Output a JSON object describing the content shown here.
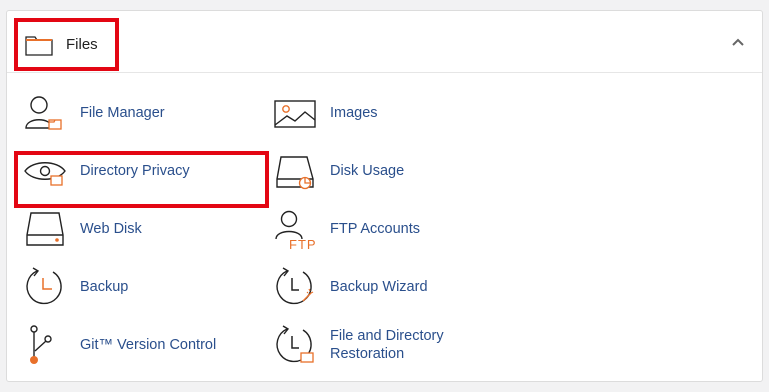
{
  "panel": {
    "title": "Files",
    "collapse_icon": "chevron-up-icon"
  },
  "items": [
    {
      "label": "File Manager",
      "icon": "file-manager-icon"
    },
    {
      "label": "Images",
      "icon": "images-icon"
    },
    {
      "label": "Directory Privacy",
      "icon": "directory-privacy-icon"
    },
    {
      "label": "Disk Usage",
      "icon": "disk-usage-icon"
    },
    {
      "label": "Web Disk",
      "icon": "web-disk-icon"
    },
    {
      "label": "FTP Accounts",
      "icon": "ftp-accounts-icon",
      "icon_text": "FTP"
    },
    {
      "label": "Backup",
      "icon": "backup-icon"
    },
    {
      "label": "Backup Wizard",
      "icon": "backup-wizard-icon"
    },
    {
      "label": "Git™ Version Control",
      "icon": "git-icon"
    },
    {
      "label": "File and Directory\nRestoration",
      "label_lines": [
        "File and Directory",
        "Restoration"
      ],
      "icon": "restore-icon"
    }
  ],
  "colors": {
    "accent": "#e8702a",
    "link": "#2a4f8c",
    "highlight": "#e30613"
  }
}
